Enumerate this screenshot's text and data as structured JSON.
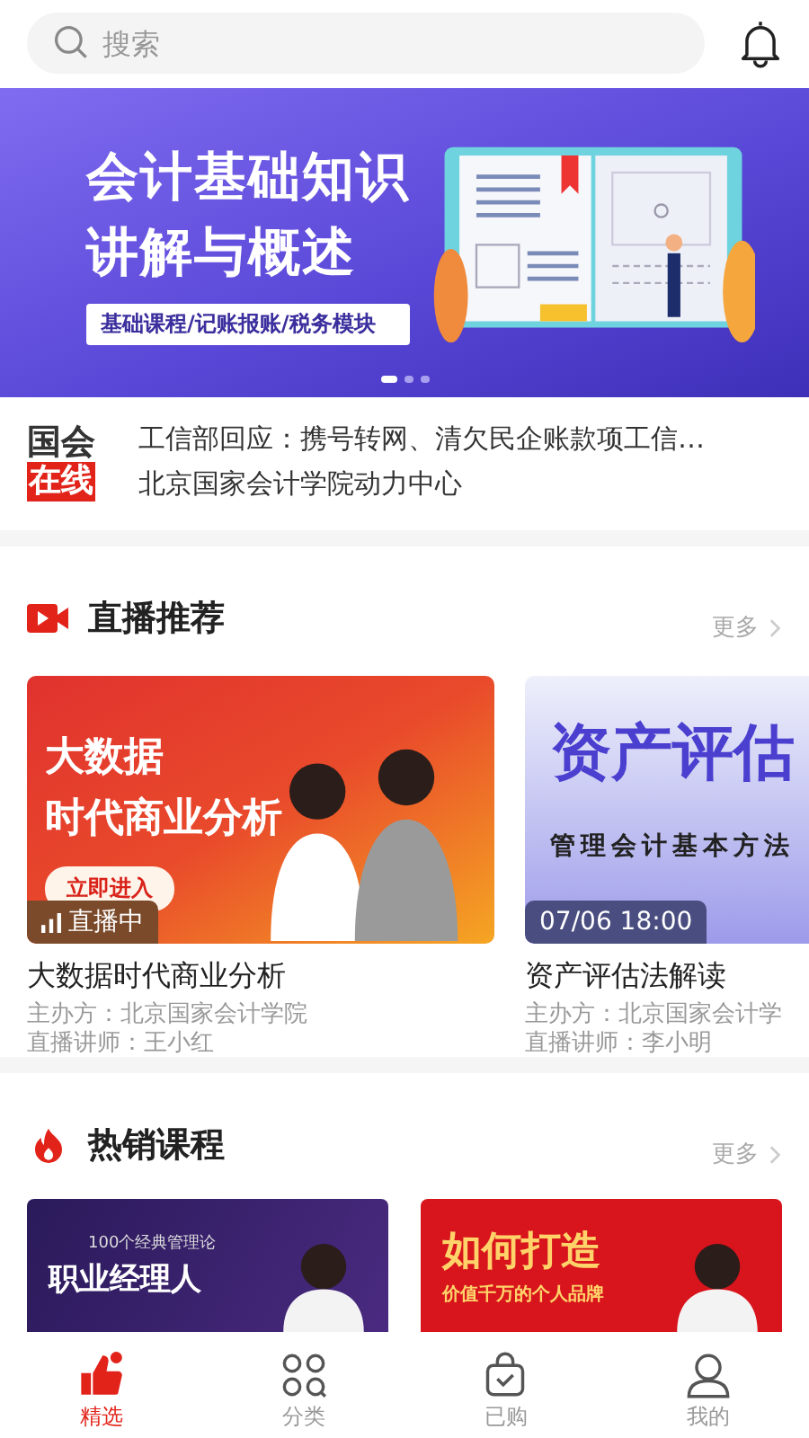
{
  "search": {
    "placeholder": "搜索"
  },
  "banner": {
    "headline": [
      "会计基础知识",
      "讲解与概述"
    ],
    "tagline": "基础课程/记账报账/税务模块",
    "pages": [
      {
        "selected": true
      },
      {
        "selected": false
      },
      {
        "selected": false
      }
    ]
  },
  "news": {
    "logo": [
      "国会",
      "在线"
    ],
    "headline": "工信部回应：携号转网、清欠民企账款项工信…",
    "source": "北京国家会计学院动力中心"
  },
  "live_section": {
    "title": "直播推荐",
    "more": "更多",
    "cards": [
      {
        "kind": "live",
        "poster": {
          "lines": [
            "大数据",
            "时代商业分析"
          ],
          "button": "立即进入"
        },
        "badge": "直播中",
        "title": "大数据时代商业分析",
        "host": "主办方：北京国家会计学院",
        "lecturer": "直播讲师：王小红"
      },
      {
        "kind": "scheduled",
        "poster": {
          "lines": [
            "资产评估",
            "管理会计基本方法"
          ]
        },
        "badge": "07/06  18:00",
        "title": "资产评估法解读",
        "host": "主办方：北京国家会计学",
        "lecturer": "直播讲师：李小明"
      }
    ]
  },
  "hot_section": {
    "title": "热销课程",
    "more": "更多",
    "cards": [
      {
        "kind": "dark",
        "poster": {
          "lines": [
            "100个经典管理论",
            "职业经理人"
          ]
        }
      },
      {
        "kind": "red",
        "poster": {
          "lines": [
            "如何打造",
            "价值千万的个人品牌"
          ]
        }
      }
    ]
  },
  "tab_bar": [
    {
      "label": "精选",
      "selected": true
    },
    {
      "label": "分类",
      "selected": false
    },
    {
      "label": "已购",
      "selected": false
    },
    {
      "label": "我的",
      "selected": false
    }
  ]
}
